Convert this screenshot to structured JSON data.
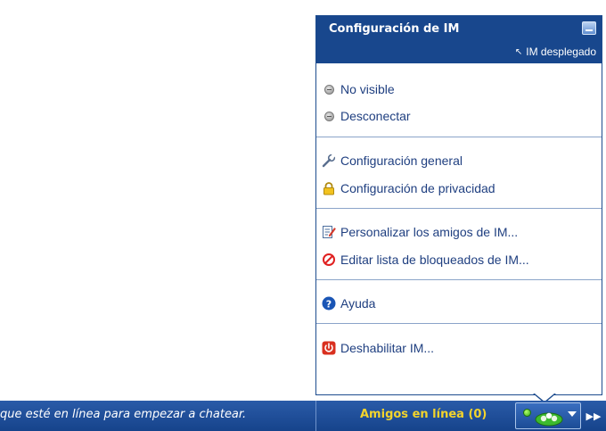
{
  "panel": {
    "title": "Configuración de IM",
    "undock_label": "IM desplegado",
    "status_items": [
      {
        "label": "No visible",
        "icon": "gray-status-icon"
      },
      {
        "label": "Desconectar",
        "icon": "gray-status-icon"
      }
    ],
    "settings_items": [
      {
        "label": "Configuración general",
        "icon": "wrench-icon"
      },
      {
        "label": "Configuración de privacidad",
        "icon": "lock-icon"
      }
    ],
    "friends_items": [
      {
        "label": "Personalizar los amigos de IM...",
        "icon": "edit-list-icon"
      },
      {
        "label": "Editar lista de bloqueados de IM...",
        "icon": "block-icon"
      }
    ],
    "help_item": {
      "label": "Ayuda",
      "icon": "help-icon"
    },
    "disable_item": {
      "label": "Deshabilitar IM...",
      "icon": "power-icon"
    }
  },
  "bottom_bar": {
    "message": "que esté en línea para empezar a chatear.",
    "friends_online": "Amigos en línea (0)"
  },
  "colors": {
    "header": "#18478d",
    "bar": "#1d4d96",
    "link": "#1f3f80",
    "friends_online": "#f3d42c"
  }
}
